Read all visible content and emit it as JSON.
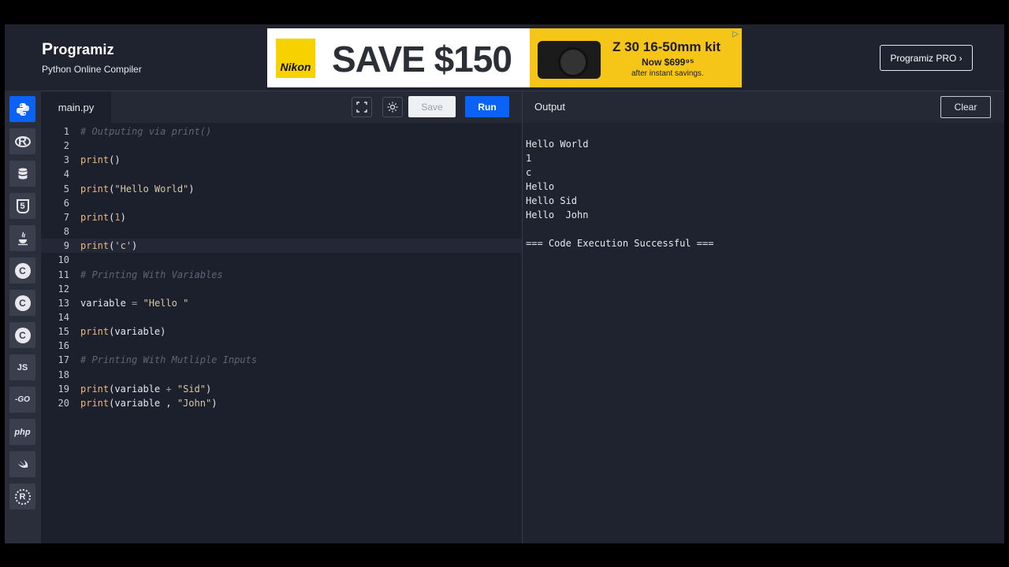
{
  "header": {
    "logo_text": "rogramiz",
    "logo_initial": "P",
    "subtitle": "Python Online Compiler",
    "pro_button": "Programiz PRO ›"
  },
  "ad": {
    "brand": "Nikon",
    "headline": "SAVE $150",
    "kit": "Z 30 16-50mm kit",
    "price": "Now $699⁹⁵",
    "savings": "after instant savings.",
    "choice_icon": "▷"
  },
  "sidebar": {
    "items": [
      {
        "name": "python",
        "label": "",
        "icon": "python-icon",
        "active": true
      },
      {
        "name": "r",
        "label": "R",
        "icon": "r-icon"
      },
      {
        "name": "sql",
        "label": "",
        "icon": "database-icon"
      },
      {
        "name": "html",
        "label": "5",
        "icon": "html5-icon"
      },
      {
        "name": "java",
        "label": "",
        "icon": "java-icon"
      },
      {
        "name": "c",
        "label": "C",
        "icon": "c-icon"
      },
      {
        "name": "cpp",
        "label": "C",
        "icon": "cpp-icon"
      },
      {
        "name": "csharp",
        "label": "C",
        "icon": "csharp-icon"
      },
      {
        "name": "js",
        "label": "JS",
        "icon": "javascript-icon"
      },
      {
        "name": "go",
        "label": "-GO",
        "icon": "go-icon"
      },
      {
        "name": "php",
        "label": "php",
        "icon": "php-icon"
      },
      {
        "name": "swift",
        "label": "",
        "icon": "swift-icon"
      },
      {
        "name": "rust",
        "label": "R",
        "icon": "rust-icon"
      }
    ]
  },
  "editor": {
    "tab": "main.py",
    "save_label": "Save",
    "run_label": "Run",
    "active_line": 9,
    "lines": [
      {
        "n": "1",
        "tokens": [
          {
            "t": "# Outputing via print()",
            "c": "com"
          }
        ]
      },
      {
        "n": "2",
        "tokens": []
      },
      {
        "n": "3",
        "tokens": [
          {
            "t": "print",
            "c": "fn"
          },
          {
            "t": "()",
            "c": "br"
          }
        ]
      },
      {
        "n": "4",
        "tokens": []
      },
      {
        "n": "5",
        "tokens": [
          {
            "t": "print",
            "c": "fn"
          },
          {
            "t": "(",
            "c": "br"
          },
          {
            "t": "\"Hello World\"",
            "c": "str"
          },
          {
            "t": ")",
            "c": "br"
          }
        ]
      },
      {
        "n": "6",
        "tokens": []
      },
      {
        "n": "7",
        "tokens": [
          {
            "t": "print",
            "c": "fn"
          },
          {
            "t": "(",
            "c": "br"
          },
          {
            "t": "1",
            "c": "num"
          },
          {
            "t": ")",
            "c": "br"
          }
        ]
      },
      {
        "n": "8",
        "tokens": []
      },
      {
        "n": "9",
        "tokens": [
          {
            "t": "print",
            "c": "fn"
          },
          {
            "t": "(",
            "c": "br"
          },
          {
            "t": "'c'",
            "c": "str"
          },
          {
            "t": ")",
            "c": "br"
          }
        ]
      },
      {
        "n": "10",
        "tokens": []
      },
      {
        "n": "11",
        "tokens": [
          {
            "t": "# Printing With Variables",
            "c": "com"
          }
        ]
      },
      {
        "n": "12",
        "tokens": []
      },
      {
        "n": "13",
        "tokens": [
          {
            "t": "variable ",
            "c": "br"
          },
          {
            "t": "=",
            "c": "op"
          },
          {
            "t": " ",
            "c": "br"
          },
          {
            "t": "\"Hello \"",
            "c": "str"
          }
        ]
      },
      {
        "n": "14",
        "tokens": []
      },
      {
        "n": "15",
        "tokens": [
          {
            "t": "print",
            "c": "fn"
          },
          {
            "t": "(variable)",
            "c": "br"
          }
        ]
      },
      {
        "n": "16",
        "tokens": []
      },
      {
        "n": "17",
        "tokens": [
          {
            "t": "# Printing With Mutliple Inputs",
            "c": "com"
          }
        ]
      },
      {
        "n": "18",
        "tokens": []
      },
      {
        "n": "19",
        "tokens": [
          {
            "t": "print",
            "c": "fn"
          },
          {
            "t": "(variable ",
            "c": "br"
          },
          {
            "t": "+",
            "c": "op"
          },
          {
            "t": " ",
            "c": "br"
          },
          {
            "t": "\"Sid\"",
            "c": "str"
          },
          {
            "t": ")",
            "c": "br"
          }
        ]
      },
      {
        "n": "20",
        "tokens": [
          {
            "t": "print",
            "c": "fn"
          },
          {
            "t": "(variable , ",
            "c": "br"
          },
          {
            "t": "\"John\"",
            "c": "str"
          },
          {
            "t": ")",
            "c": "br"
          }
        ]
      }
    ]
  },
  "output": {
    "title": "Output",
    "clear_label": "Clear",
    "lines": [
      "Hello World",
      "1",
      "c",
      "Hello",
      "Hello Sid",
      "Hello  John",
      "",
      "=== Code Execution Successful ==="
    ]
  }
}
